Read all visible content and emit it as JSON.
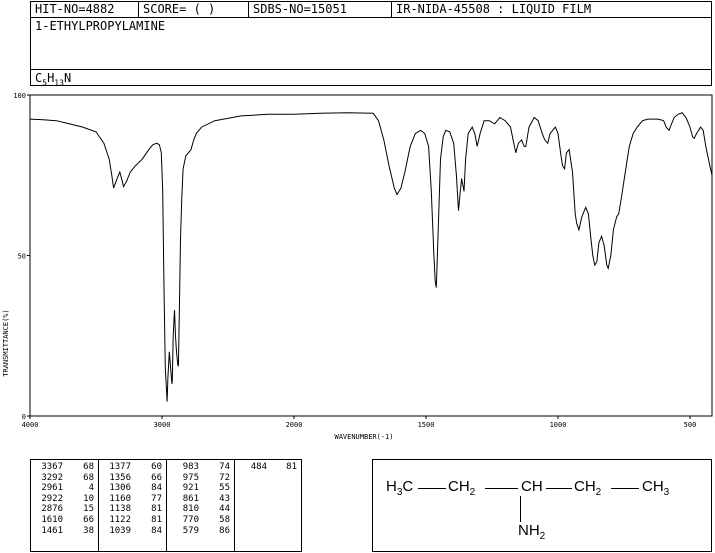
{
  "header": {
    "hit_no": "HIT-NO=4882",
    "score": "SCORE=  (   )",
    "sdbs_no": "SDBS-NO=15051",
    "ir_nida": "IR-NIDA-45508 : LIQUID FILM"
  },
  "compound_name": "1-ETHYLPROPYLAMINE",
  "formula": {
    "c": "C",
    "c_n": "5",
    "h": "H",
    "h_n": "13",
    "n": "N"
  },
  "chart_data": {
    "type": "line",
    "xlabel": "WAVENUMBER(-1)",
    "ylabel": "TRANSMITTANCE(%)",
    "x_ticks": [
      "4000",
      "3000",
      "2000",
      "1500",
      "1000",
      "500"
    ],
    "y_ticks": [
      "100",
      "50",
      "0"
    ],
    "xlim": [
      4000,
      400
    ],
    "ylim": [
      0,
      100
    ],
    "x_reversed": true,
    "color": "#000000",
    "series": [
      {
        "points": [
          [
            4000,
            92.5
          ],
          [
            3900,
            92.3
          ],
          [
            3800,
            92
          ],
          [
            3700,
            91
          ],
          [
            3600,
            90
          ],
          [
            3500,
            88.5
          ],
          [
            3440,
            85
          ],
          [
            3400,
            80
          ],
          [
            3380,
            75
          ],
          [
            3367,
            71
          ],
          [
            3340,
            74
          ],
          [
            3320,
            76
          ],
          [
            3300,
            73
          ],
          [
            3292,
            71.5
          ],
          [
            3270,
            73
          ],
          [
            3240,
            76
          ],
          [
            3200,
            78
          ],
          [
            3150,
            80
          ],
          [
            3100,
            83
          ],
          [
            3070,
            84.5
          ],
          [
            3040,
            85
          ],
          [
            3020,
            84.5
          ],
          [
            3005,
            82
          ],
          [
            2995,
            70
          ],
          [
            2985,
            40
          ],
          [
            2975,
            15
          ],
          [
            2966,
            8
          ],
          [
            2961,
            4.5
          ],
          [
            2955,
            12
          ],
          [
            2945,
            20
          ],
          [
            2935,
            15
          ],
          [
            2925,
            10
          ],
          [
            2922,
            11
          ],
          [
            2915,
            25
          ],
          [
            2905,
            33
          ],
          [
            2898,
            25
          ],
          [
            2890,
            20
          ],
          [
            2880,
            16
          ],
          [
            2876,
            15.5
          ],
          [
            2870,
            30
          ],
          [
            2860,
            55
          ],
          [
            2850,
            68
          ],
          [
            2840,
            77
          ],
          [
            2820,
            81
          ],
          [
            2800,
            82
          ],
          [
            2780,
            83
          ],
          [
            2760,
            86
          ],
          [
            2740,
            88
          ],
          [
            2700,
            90
          ],
          [
            2600,
            92
          ],
          [
            2400,
            93.5
          ],
          [
            2200,
            94
          ],
          [
            2000,
            94
          ],
          [
            1900,
            94.3
          ],
          [
            1800,
            94.5
          ],
          [
            1700,
            94.3
          ],
          [
            1680,
            92
          ],
          [
            1660,
            86
          ],
          [
            1640,
            78
          ],
          [
            1620,
            71
          ],
          [
            1610,
            69
          ],
          [
            1595,
            71
          ],
          [
            1580,
            76
          ],
          [
            1560,
            84
          ],
          [
            1540,
            88
          ],
          [
            1520,
            89
          ],
          [
            1505,
            88
          ],
          [
            1490,
            84
          ],
          [
            1480,
            70
          ],
          [
            1470,
            50
          ],
          [
            1465,
            42
          ],
          [
            1461,
            40
          ],
          [
            1455,
            55
          ],
          [
            1445,
            80
          ],
          [
            1435,
            87
          ],
          [
            1425,
            89
          ],
          [
            1410,
            88.5
          ],
          [
            1395,
            85
          ],
          [
            1385,
            75
          ],
          [
            1377,
            64
          ],
          [
            1370,
            70
          ],
          [
            1365,
            74
          ],
          [
            1356,
            70
          ],
          [
            1350,
            80
          ],
          [
            1340,
            88
          ],
          [
            1325,
            90
          ],
          [
            1315,
            88
          ],
          [
            1306,
            84
          ],
          [
            1295,
            88
          ],
          [
            1280,
            92
          ],
          [
            1260,
            92
          ],
          [
            1240,
            91
          ],
          [
            1220,
            93
          ],
          [
            1200,
            92
          ],
          [
            1180,
            90
          ],
          [
            1170,
            86
          ],
          [
            1160,
            82
          ],
          [
            1150,
            85
          ],
          [
            1138,
            86
          ],
          [
            1128,
            84
          ],
          [
            1122,
            84
          ],
          [
            1110,
            90
          ],
          [
            1090,
            93
          ],
          [
            1075,
            92
          ],
          [
            1060,
            88
          ],
          [
            1050,
            86
          ],
          [
            1039,
            85
          ],
          [
            1030,
            88
          ],
          [
            1020,
            89
          ],
          [
            1010,
            90
          ],
          [
            1000,
            88
          ],
          [
            990,
            82
          ],
          [
            983,
            78
          ],
          [
            975,
            77
          ],
          [
            968,
            82
          ],
          [
            958,
            83
          ],
          [
            945,
            76
          ],
          [
            935,
            63
          ],
          [
            929,
            60
          ],
          [
            921,
            58
          ],
          [
            910,
            62
          ],
          [
            895,
            65
          ],
          [
            885,
            63
          ],
          [
            875,
            55
          ],
          [
            868,
            50
          ],
          [
            861,
            47
          ],
          [
            853,
            48
          ],
          [
            845,
            54
          ],
          [
            835,
            56
          ],
          [
            825,
            53
          ],
          [
            815,
            47
          ],
          [
            810,
            46
          ],
          [
            800,
            50
          ],
          [
            790,
            58
          ],
          [
            778,
            62
          ],
          [
            770,
            63
          ],
          [
            760,
            68
          ],
          [
            745,
            76
          ],
          [
            730,
            84
          ],
          [
            715,
            88
          ],
          [
            700,
            90
          ],
          [
            680,
            92
          ],
          [
            660,
            92.5
          ],
          [
            640,
            92.5
          ],
          [
            620,
            92.5
          ],
          [
            600,
            92
          ],
          [
            590,
            90
          ],
          [
            579,
            89
          ],
          [
            570,
            91
          ],
          [
            560,
            93
          ],
          [
            545,
            94
          ],
          [
            530,
            94.5
          ],
          [
            515,
            93
          ],
          [
            500,
            90
          ],
          [
            490,
            87
          ],
          [
            484,
            86.5
          ],
          [
            475,
            88
          ],
          [
            460,
            90
          ],
          [
            450,
            89
          ],
          [
            440,
            84
          ],
          [
            425,
            78
          ],
          [
            410,
            75
          ],
          [
            400,
            74
          ]
        ]
      }
    ]
  },
  "peak_table": {
    "columns": [
      [
        [
          "3367",
          "68"
        ],
        [
          "3292",
          "68"
        ],
        [
          "2961",
          "4"
        ],
        [
          "2922",
          "10"
        ],
        [
          "2876",
          "15"
        ],
        [
          "1610",
          "66"
        ],
        [
          "1461",
          "38"
        ]
      ],
      [
        [
          "1377",
          "60"
        ],
        [
          "1356",
          "66"
        ],
        [
          "1306",
          "84"
        ],
        [
          "1160",
          "77"
        ],
        [
          "1138",
          "81"
        ],
        [
          "1122",
          "81"
        ],
        [
          "1039",
          "84"
        ]
      ],
      [
        [
          "983",
          "74"
        ],
        [
          "975",
          "72"
        ],
        [
          "921",
          "55"
        ],
        [
          "861",
          "43"
        ],
        [
          "810",
          "44"
        ],
        [
          "770",
          "58"
        ],
        [
          "579",
          "86"
        ]
      ],
      [
        [
          "484",
          "81"
        ]
      ]
    ]
  },
  "structure": {
    "h3c": "H",
    "h3c_sub": "3",
    "h3c_c": "C",
    "ch2a": "CH",
    "ch2a_sub": "2",
    "ch": "CH",
    "ch2b": "CH",
    "ch2b_sub": "2",
    "ch3": "CH",
    "ch3_sub": "3",
    "nh2": "NH",
    "nh2_sub": "2"
  }
}
